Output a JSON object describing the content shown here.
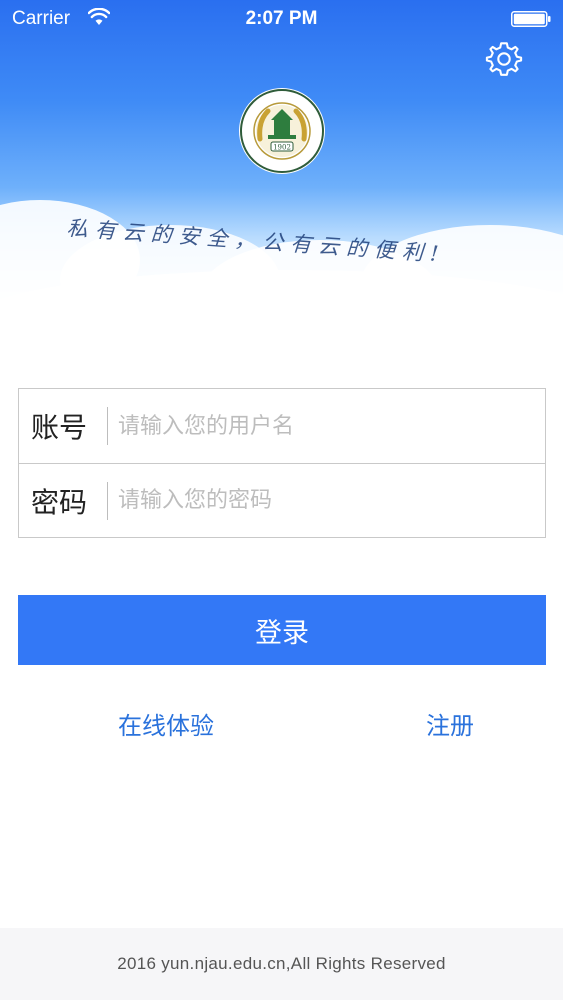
{
  "status_bar": {
    "carrier": "Carrier",
    "time": "2:07 PM"
  },
  "header": {
    "slogan": "私有云的安全，公有云的便利!",
    "logo": {
      "year": "1902",
      "icon": "university-seal-icon"
    },
    "settings_icon": "gear-icon"
  },
  "form": {
    "account": {
      "label": "账号",
      "placeholder": "请输入您的用户名",
      "value": ""
    },
    "password": {
      "label": "密码",
      "placeholder": "请输入您的密码",
      "value": ""
    }
  },
  "actions": {
    "login_label": "登录",
    "trial_label": "在线体验",
    "register_label": "注册"
  },
  "footer": {
    "copyright": "2016 yun.njau.edu.cn,All Rights Reserved"
  },
  "colors": {
    "primary": "#3378f6",
    "link": "#2a72dc",
    "sky_top": "#2a6ff0",
    "footer_bg": "#f6f6f8"
  }
}
